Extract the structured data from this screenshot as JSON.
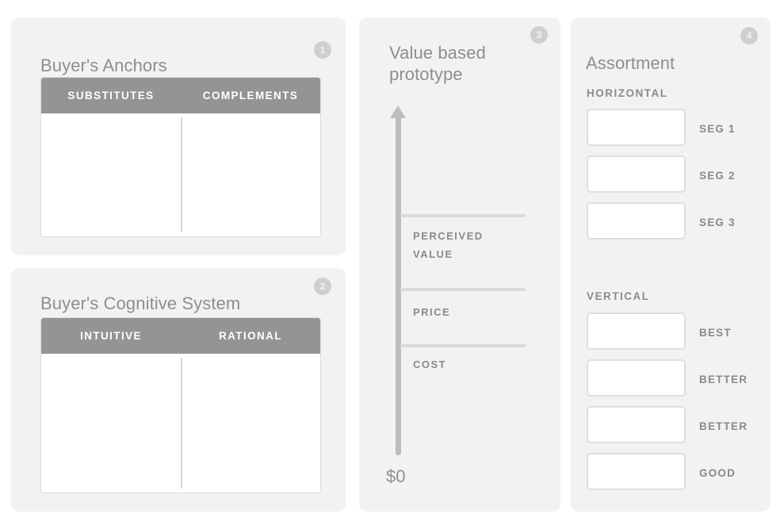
{
  "panels": [
    {
      "badge": "1",
      "title": "Buyer's Anchors",
      "columns": [
        "SUBSTITUTES",
        "COMPLEMENTS"
      ]
    },
    {
      "badge": "2",
      "title": "Buyer's Cognitive System",
      "columns": [
        "INTUITIVE",
        "RATIONAL"
      ]
    },
    {
      "badge": "3",
      "title": "Value based\nprototype",
      "axis_base_label": "$0",
      "levels": [
        {
          "label": "PERCEIVED\nVALUE"
        },
        {
          "label": "PRICE"
        },
        {
          "label": "COST"
        }
      ]
    },
    {
      "badge": "4",
      "title": "Assortment",
      "groups": [
        {
          "label": "HORIZONTAL",
          "items": [
            "SEG 1",
            "SEG 2",
            "SEG 3"
          ]
        },
        {
          "label": "VERTICAL",
          "items": [
            "BEST",
            "BETTER",
            "BETTER",
            "GOOD"
          ]
        }
      ]
    }
  ],
  "colors": {
    "page_background": "#ffffff",
    "panel_background": "#f2f2f2",
    "header_bar": "#949494",
    "badge": "#cfcfcf",
    "text_muted": "#8a8a8a",
    "title": "#8e8e8e",
    "axis": "#bdbdbd",
    "level_line": "#dadada",
    "swatch_border": "#dedede",
    "card_border": "#dcdcdc"
  }
}
